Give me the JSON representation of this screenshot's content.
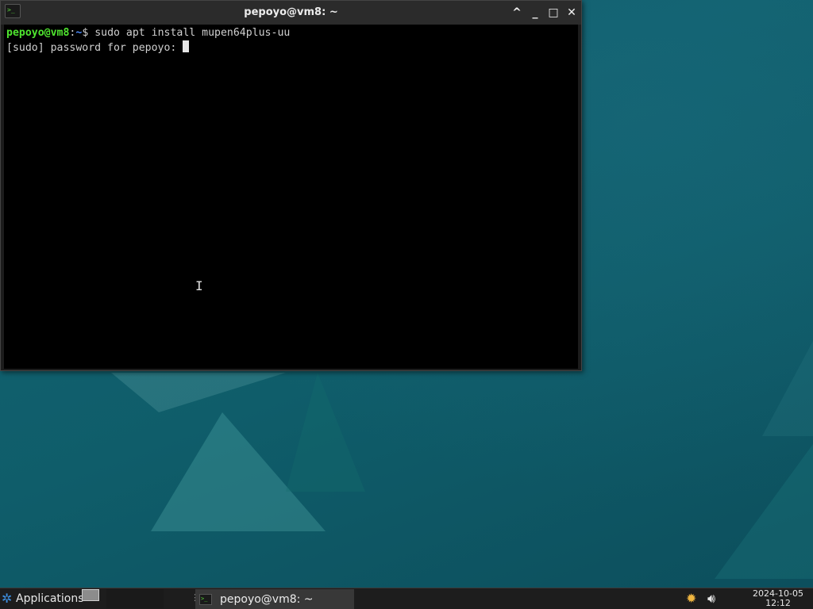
{
  "window": {
    "title": "pepoyo@vm8: ~",
    "app_icon": "terminal-icon",
    "buttons": {
      "shade": "^",
      "minimize": "_",
      "maximize": "□",
      "close": "✕"
    }
  },
  "terminal": {
    "lines": [
      {
        "user_host": "pepoyo@vm8",
        "sep": ":",
        "path": "~",
        "suffix": "$ sudo apt install mupen64plus-uu"
      },
      {
        "text": "[sudo] password for pepoyo: "
      }
    ],
    "colors": {
      "background": "#000000",
      "prompt_user": "#4fe52f",
      "prompt_path": "#4e8eff",
      "text": "#d0d0d0"
    }
  },
  "taskbar": {
    "applications_label": "Applications",
    "task_label": "pepoyo@vm8: ~",
    "clock": {
      "date": "2024-10-05",
      "time": "12:12"
    },
    "tray_icons": [
      "bug-icon",
      "volume-icon"
    ]
  }
}
